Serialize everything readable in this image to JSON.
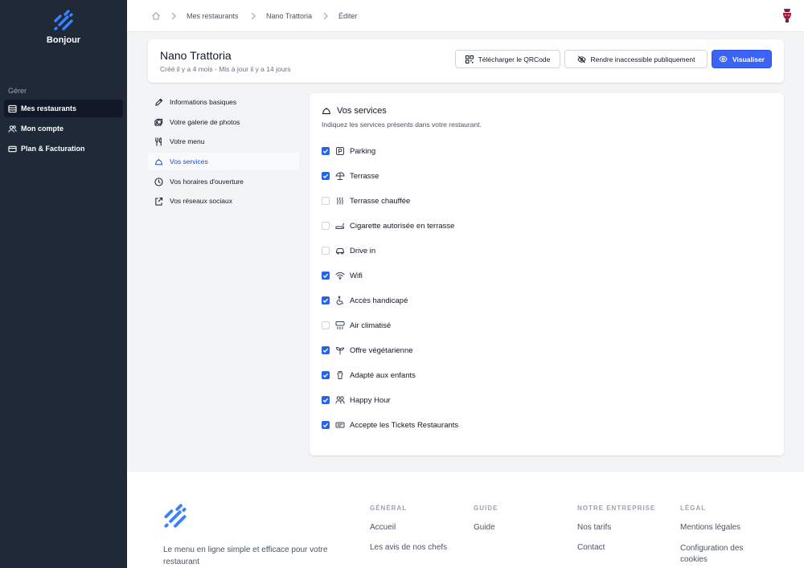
{
  "brand": {
    "name": "Bonjour"
  },
  "sidebar": {
    "section": "Gérer",
    "items": [
      {
        "label": "Mes restaurants",
        "icon": "stack-icon",
        "active": true
      },
      {
        "label": "Mon compte",
        "icon": "users-icon"
      },
      {
        "label": "Plan & Facturation",
        "icon": "credit-card-icon"
      }
    ]
  },
  "breadcrumb": {
    "items": [
      "Mes restaurants",
      "Nano Trattoria",
      "Éditer"
    ]
  },
  "restaurant": {
    "name": "Nano Trattoria",
    "meta": "Créé il y a 4 mois - Mis à jour il y a 14 jours"
  },
  "actions": {
    "qrcode": "Télécharger le QRCode",
    "hide": "Rendre inaccessible publiquement",
    "view": "Visualiser"
  },
  "subnav": [
    {
      "label": "Informations basiques",
      "icon": "pencil-icon"
    },
    {
      "label": "Votre galerie de photos",
      "icon": "photos-icon"
    },
    {
      "label": "Votre menu",
      "icon": "utensils-icon"
    },
    {
      "label": "Vos services",
      "icon": "cloche-icon",
      "active": true
    },
    {
      "label": "Vos horaires d'ouverture",
      "icon": "clock-icon"
    },
    {
      "label": "Vos réseaux sociaux",
      "icon": "share-icon"
    }
  ],
  "services": {
    "title": "Vos services",
    "description": "Indiquez les services présents dans votre restaurant.",
    "items": [
      {
        "label": "Parking",
        "icon": "parking-icon",
        "checked": true
      },
      {
        "label": "Terrasse",
        "icon": "umbrella-icon",
        "checked": true
      },
      {
        "label": "Terrasse chauffée",
        "icon": "heat-icon",
        "checked": false
      },
      {
        "label": "Cigarette autorisée en terrasse",
        "icon": "cigarette-icon",
        "checked": false
      },
      {
        "label": "Drive in",
        "icon": "car-icon",
        "checked": false
      },
      {
        "label": "Wifi",
        "icon": "wifi-icon",
        "checked": true
      },
      {
        "label": "Accès handicapé",
        "icon": "wheelchair-icon",
        "checked": true
      },
      {
        "label": "Air climatisé",
        "icon": "air-conditioner-icon",
        "checked": false
      },
      {
        "label": "Offre végétarienne",
        "icon": "sprout-icon",
        "checked": true
      },
      {
        "label": "Adapté aux enfants",
        "icon": "baby-icon",
        "checked": true
      },
      {
        "label": "Happy Hour",
        "icon": "people-icon",
        "checked": true
      },
      {
        "label": "Accepte les Tickets Restaurants",
        "icon": "ticket-icon",
        "checked": true
      }
    ]
  },
  "footer": {
    "tagline": "Le menu en ligne simple et efficace pour votre restaurant",
    "columns": [
      {
        "title": "GÉNÉRAL",
        "links": [
          "Accueil",
          "Les avis de nos chefs"
        ]
      },
      {
        "title": "GUIDE",
        "links": [
          "Guide"
        ]
      },
      {
        "title": "NOTRE ENTREPRISE",
        "links": [
          "Nos tarifs",
          "Contact"
        ]
      },
      {
        "title": "LÉGAL",
        "links": [
          "Mentions légales",
          "Configuration des cookies"
        ]
      }
    ]
  },
  "colors": {
    "sidebar": "#1f2937",
    "accent": "#3b64f5",
    "checkbox": "#2563eb",
    "logo": "#3b82f6"
  }
}
